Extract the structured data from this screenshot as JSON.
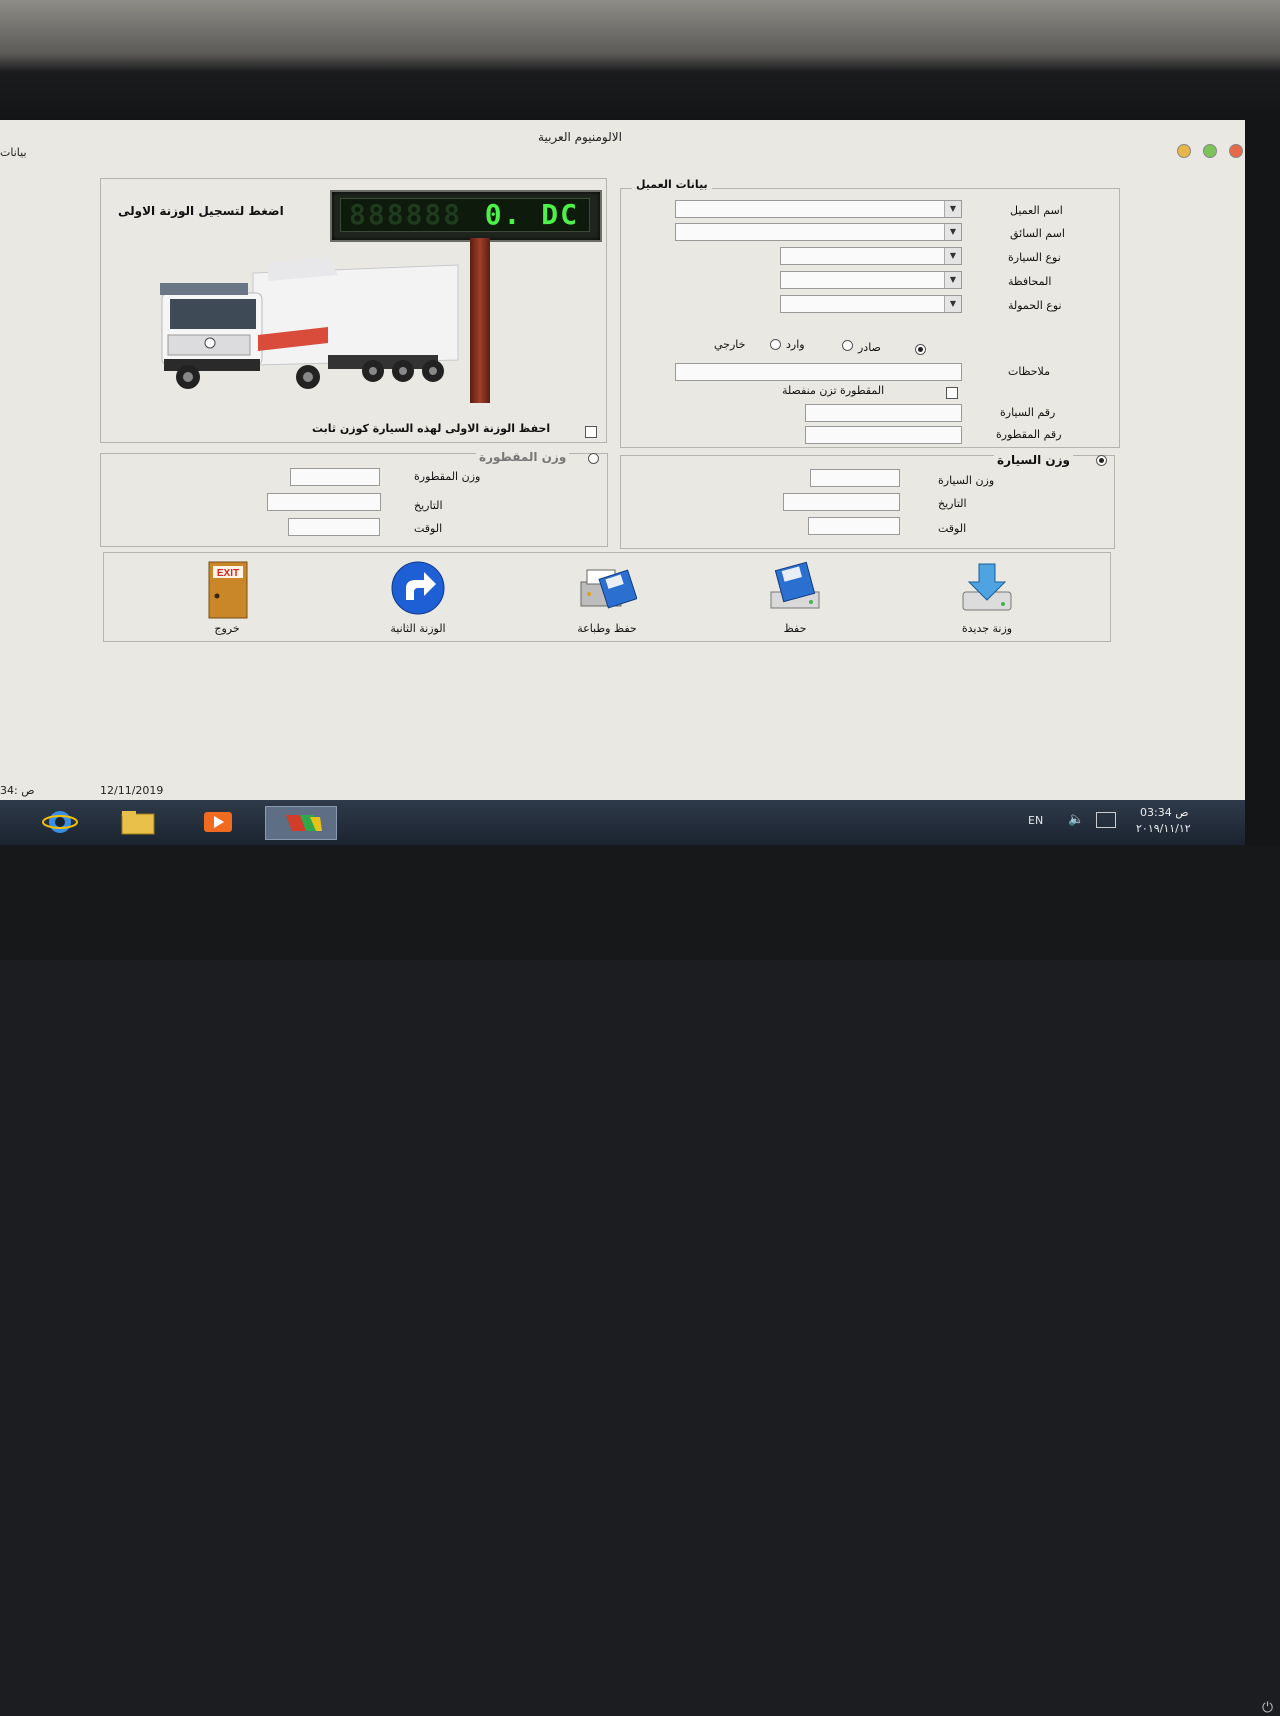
{
  "window": {
    "title": "الالومنيوم العربية",
    "left_title": "بيانات"
  },
  "scale": {
    "instruction": "اضغط لتسجيل الوزنة الاولى",
    "display": "0. DC",
    "save_first_weight": "احفظ الوزنة الاولى لهذه السيارة كوزن ثابت"
  },
  "customer": {
    "group_title": "بيانات العميل",
    "customer_name_label": "اسم العميل",
    "driver_name_label": "اسم السائق",
    "vehicle_type_label": "نوع السيارة",
    "governorate_label": "المحافظة",
    "load_type_label": "نوع الحمولة",
    "direction": {
      "export": "صادر",
      "import": "وارد",
      "external": "خارجي",
      "selected": "export"
    },
    "notes_label": "ملاحظات",
    "trailer_separate_label": "المقطورة تزن منفصلة",
    "vehicle_number_label": "رقم السيارة",
    "trailer_number_label": "رقم المقطورة"
  },
  "vehicle_weight": {
    "title": "وزن السيارة",
    "weight_label": "وزن السيارة",
    "date_label": "التاريخ",
    "time_label": "الوقت"
  },
  "trailer_weight": {
    "title": "وزن المقطورة",
    "weight_label": "وزن المقطورة",
    "date_label": "التاريخ",
    "time_label": "الوقت"
  },
  "toolbar": {
    "exit_label": "خروج",
    "exit_icon_text": "EXIT",
    "second_weight_label": "الوزنة الثانية",
    "save_print_label": "حفظ وطباعة",
    "save_label": "حفظ",
    "new_weight_label": "وزنة جديدة"
  },
  "statusbar": {
    "time": "34: ص",
    "date": "12/11/2019"
  },
  "taskbar": {
    "lang": "EN",
    "clock_time": "03:34 ص",
    "clock_date": "٢٠١٩/١١/١٢"
  },
  "colors": {
    "led": "#4ef04a",
    "window_bg": "#e9e8e3",
    "taskbar": "#1b2330"
  }
}
